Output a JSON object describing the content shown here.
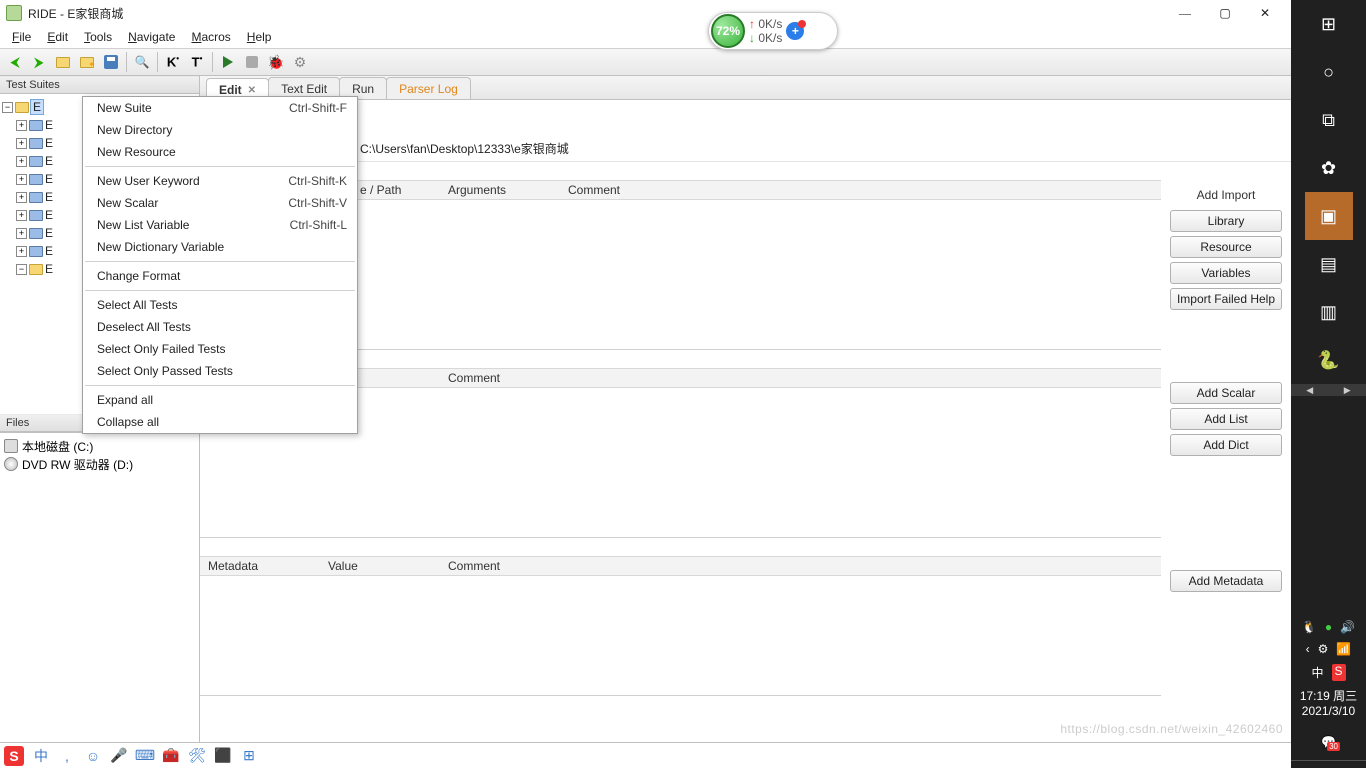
{
  "title": "RIDE - E家银商城",
  "menus": [
    "File",
    "Edit",
    "Tools",
    "Navigate",
    "Macros",
    "Help"
  ],
  "net": {
    "pct": "72%",
    "up": "0K/s",
    "down": "0K/s"
  },
  "panels": {
    "suites": "Test Suites",
    "files": "Files"
  },
  "tree": {
    "root": "E",
    "children": [
      "E",
      "E",
      "E",
      "E",
      "E",
      "E",
      "E",
      "E",
      "E"
    ]
  },
  "files": [
    {
      "icon": "disk",
      "label": "本地磁盘 (C:)"
    },
    {
      "icon": "dvd",
      "label": "DVD RW 驱动器 (D:)"
    }
  ],
  "tabs": [
    {
      "label": "Edit",
      "active": true,
      "closable": true
    },
    {
      "label": "Text Edit"
    },
    {
      "label": "Run"
    },
    {
      "label": "Parser Log",
      "orange": true
    }
  ],
  "source_path": "C:\\Users\\fan\\Desktop\\12333\\e家银商城",
  "imports": {
    "header": "Add Import",
    "cols": [
      "e / Path",
      "Arguments",
      "Comment"
    ],
    "buttons": [
      "Library",
      "Resource",
      "Variables",
      "Import Failed Help"
    ]
  },
  "vars": {
    "cols": [
      "",
      "Comment",
      ""
    ],
    "buttons": [
      "Add Scalar",
      "Add List",
      "Add Dict"
    ]
  },
  "meta": {
    "cols": [
      "Metadata",
      "Value",
      "Comment"
    ],
    "buttons": [
      "Add Metadata"
    ]
  },
  "context_menu": [
    {
      "label": "New Suite",
      "shortcut": "Ctrl-Shift-F"
    },
    {
      "label": "New Directory"
    },
    {
      "label": "New Resource"
    },
    {
      "sep": true
    },
    {
      "label": "New User Keyword",
      "shortcut": "Ctrl-Shift-K"
    },
    {
      "label": "New Scalar",
      "shortcut": "Ctrl-Shift-V"
    },
    {
      "label": "New List Variable",
      "shortcut": "Ctrl-Shift-L"
    },
    {
      "label": "New Dictionary Variable"
    },
    {
      "sep": true
    },
    {
      "label": "Change Format"
    },
    {
      "sep": true
    },
    {
      "label": "Select All Tests"
    },
    {
      "label": "Deselect All Tests"
    },
    {
      "label": "Select Only Failed Tests"
    },
    {
      "label": "Select Only Passed Tests"
    },
    {
      "sep": true
    },
    {
      "label": "Expand all"
    },
    {
      "label": "Collapse all"
    }
  ],
  "ime": [
    "S",
    "中",
    ",",
    "☺",
    "🎤",
    "⌨",
    "🧰",
    "🛠",
    "⬛",
    "⊞"
  ],
  "taskbar": {
    "items": [
      "⊞",
      "○",
      "⧉",
      "✿",
      "▣",
      "▤",
      "▥",
      "🐍"
    ],
    "tray1": [
      "🐧",
      "●",
      "🔊"
    ],
    "tray2": [
      "‹",
      "⚙",
      "📶"
    ],
    "tray3": [
      "中",
      "S"
    ],
    "time": "17:19 周三",
    "date": "2021/3/10",
    "notif": "30"
  },
  "watermark": "https://blog.csdn.net/weixin_42602460"
}
